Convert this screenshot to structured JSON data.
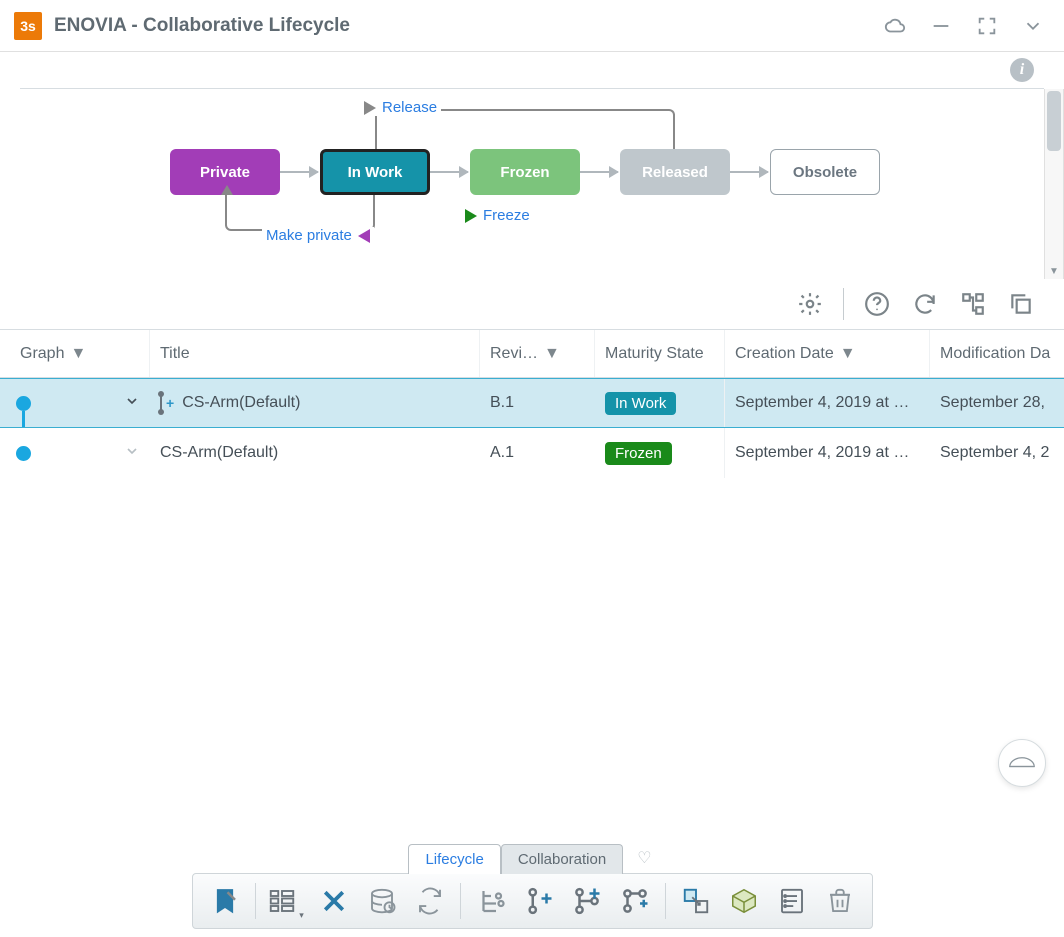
{
  "app": {
    "icon_text": "3s",
    "title": "ENOVIA - Collaborative Lifecycle"
  },
  "lifecycle": {
    "states": {
      "private": "Private",
      "inwork": "In Work",
      "frozen": "Frozen",
      "released": "Released",
      "obsolete": "Obsolete"
    },
    "actions": {
      "release": "Release",
      "freeze": "Freeze",
      "make_private": "Make private"
    }
  },
  "columns": {
    "graph": "Graph",
    "title": "Title",
    "rev": "Revi…",
    "maturity": "Maturity State",
    "created": "Creation Date",
    "modified": "Modification Da"
  },
  "rows": [
    {
      "title": "CS-Arm(Default)",
      "rev": "B.1",
      "maturity": "In Work",
      "maturity_class": "inwork",
      "created": "September 4, 2019 at …",
      "modified": "September 28,",
      "selected": true,
      "has_plus": true
    },
    {
      "title": "CS-Arm(Default)",
      "rev": "A.1",
      "maturity": "Frozen",
      "maturity_class": "frozen",
      "created": "September 4, 2019 at …",
      "modified": "September 4, 2",
      "selected": false,
      "has_plus": false
    }
  ],
  "tabs": {
    "lifecycle": "Lifecycle",
    "collaboration": "Collaboration"
  }
}
